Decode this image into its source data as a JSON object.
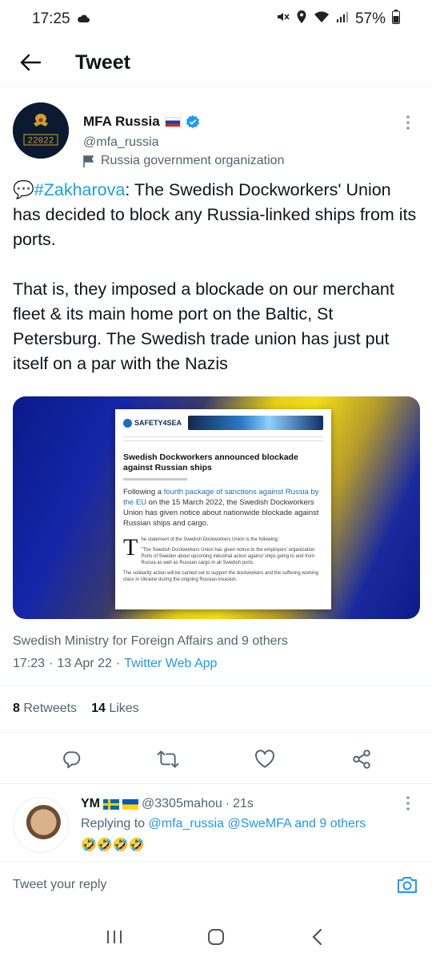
{
  "status_bar": {
    "time": "17:25",
    "battery": "57%"
  },
  "header": {
    "title": "Tweet"
  },
  "author": {
    "name": "MFA Russia",
    "handle": "@mfa_russia",
    "label": "Russia government organization",
    "avatar_text": "22022"
  },
  "tweet": {
    "emoji": "💬",
    "hashtag": "#Zakharova",
    "paragraph1_rest": ": The Swedish Dockworkers' Union has decided to block any Russia-linked ships from its ports.",
    "paragraph2": "That is, they imposed a blockade on our merchant fleet & its main home port on the Baltic, St Petersburg. The Swedish trade union has just put itself on a par with the Nazis"
  },
  "media": {
    "logo": "SAFETY4SEA",
    "title": "Swedish Dockworkers announced blockade against Russian ships",
    "lead_pre": "Following a ",
    "lead_link": "fourth package of sanctions against Russia by the EU",
    "lead_post": " on the 15 March 2022, the Swedish Dockworkers Union has given notice about nationwide blockade against Russian ships and cargo.",
    "dropcap": "T",
    "body1": "he statement of the Swedish Dockworkers Union is the following:",
    "body2": "\"The Swedish Dockworkers Union has given notice to the employers' organization Ports of Sweden about upcoming industrial action against ships going to and from Russia as well as Russian cargo in all Swedish ports.",
    "body3": "The solidarity action will be carried out to support the dockworkers and the suffering working class in Ukraine during the ongoing Russian invasion."
  },
  "tagged": "Swedish Ministry for Foreign Affairs and 9 others",
  "timestamp": {
    "time": "17:23",
    "sep1": "·",
    "date": "13 Apr 22",
    "sep2": "·",
    "app": "Twitter Web App"
  },
  "stats": {
    "retweets_count": "8",
    "retweets_label": "Retweets",
    "likes_count": "14",
    "likes_label": "Likes"
  },
  "actions": [
    "reply-icon",
    "retweet-icon",
    "like-icon",
    "share-icon"
  ],
  "reply": {
    "name": "YM",
    "handle": "@3305mahou",
    "sep": "·",
    "time": "21s",
    "replying_prefix": "Replying to ",
    "mention1": "@mfa_russia",
    "mention2": "@SweMFA",
    "and_others": "and 9 others",
    "text": "🤣🤣🤣🤣"
  },
  "compose": {
    "placeholder": "Tweet your reply"
  },
  "colors": {
    "accent": "#1d9bf0",
    "text": "#0f1419",
    "secondary": "#536471"
  }
}
